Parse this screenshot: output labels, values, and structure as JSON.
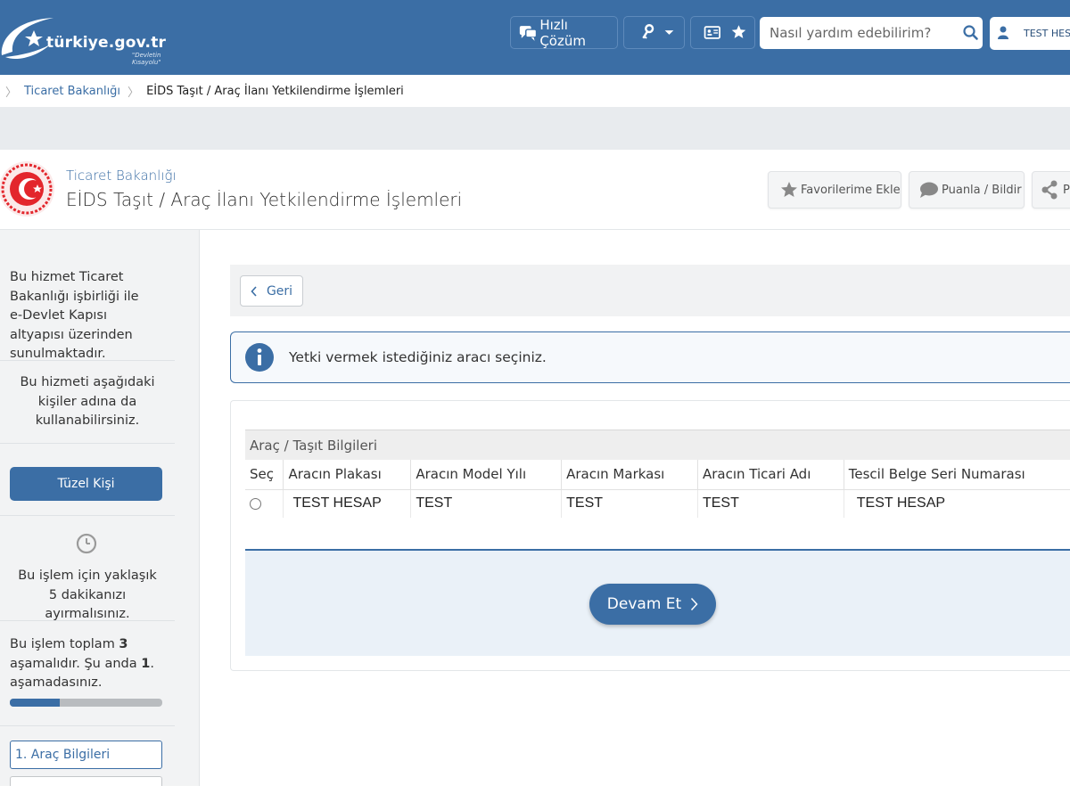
{
  "header": {
    "logo_text": "türkiye.gov.tr",
    "logo_sub": "\"Devletin Kısayolu\"",
    "quick_solution_label": "Hızlı Çözüm",
    "search_placeholder": "Nasıl yardım edebilirim?",
    "user_label": "TEST HESAP"
  },
  "breadcrumb": {
    "items": [
      "Ticaret Bakanlığı",
      "EİDS Taşıt / Araç İlanı Yetkilendirme İşlemleri"
    ]
  },
  "service": {
    "organization": "Ticaret Bakanlığı",
    "title": "EİDS Taşıt / Araç İlanı Yetkilendirme İşlemleri",
    "actions": {
      "favorite": "Favorilerime Ekle",
      "rate": "Puanla / Bildir",
      "share": "P"
    }
  },
  "sidebar": {
    "provider_text": "Bu hizmet Ticaret Bakanlığı işbirliği ile e-Devlet Kapısı altyapısı üzerinden sunulmaktadır.",
    "on_behalf_text": "Bu hizmeti aşağıdaki kişiler adına da kullanabilirsiniz.",
    "tuzel_button": "Tüzel Kişi",
    "time_text": "Bu işlem için yaklaşık 5 dakikanızı ayırmalısınız.",
    "steps_prefix": "Bu işlem toplam ",
    "steps_total": "3",
    "steps_middle": " aşamalıdır. Şu anda ",
    "steps_current": "1",
    "steps_suffix": ". aşamadasınız.",
    "progress": 0.33,
    "step_items": [
      "1. Araç Bilgileri"
    ]
  },
  "main": {
    "back_label": "Geri",
    "info_message": "Yetki vermek istediğiniz aracı seçiniz.",
    "table": {
      "caption": "Araç / Taşıt Bilgileri",
      "columns": [
        "Seç",
        "Aracın Plakası",
        "Aracın Model Yılı",
        "Aracın Markası",
        "Aracın Ticari Adı",
        "Tescil Belge Seri Numarası"
      ],
      "rows": [
        [
          "",
          "TEST HESAP",
          "TEST",
          "TEST",
          "TEST",
          "TEST HESAP"
        ]
      ]
    },
    "continue_label": "Devam Et"
  },
  "colors": {
    "primary": "#3b6ea5",
    "header_bg": "#3b6ea5",
    "seal_red": "#e3262c"
  }
}
